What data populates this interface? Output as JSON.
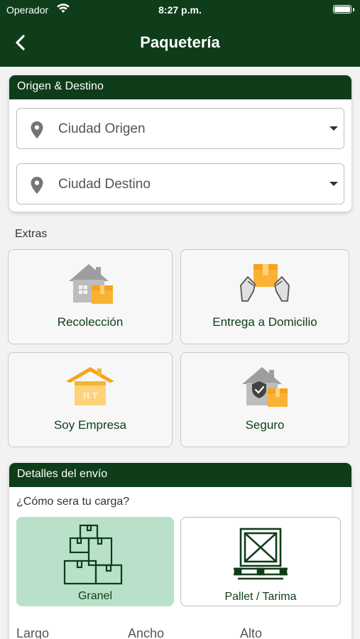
{
  "status_bar": {
    "carrier": "Operador",
    "time": "8:27 p.m."
  },
  "nav": {
    "title": "Paquetería"
  },
  "route": {
    "header": "Origen & Destino",
    "origin_placeholder": "Ciudad Origen",
    "destination_placeholder": "Ciudad Destino"
  },
  "extras": {
    "label": "Extras",
    "items": [
      {
        "label": "Recolección",
        "icon": "house-pickup-icon"
      },
      {
        "label": "Entrega a Domicilio",
        "icon": "package-delivery-icon"
      },
      {
        "label": "Soy Empresa",
        "icon": "company-building-icon"
      },
      {
        "label": "Seguro",
        "icon": "insurance-shield-icon"
      }
    ]
  },
  "details": {
    "header": "Detalles del envío",
    "question": "¿Cómo sera tu carga?",
    "options": [
      {
        "label": "Granel",
        "icon": "boxes-icon",
        "selected": true
      },
      {
        "label": "Pallet / Tarima",
        "icon": "pallet-crate-icon",
        "selected": false
      }
    ],
    "dimensions": [
      "Largo",
      "Ancho",
      "Alto"
    ]
  },
  "colors": {
    "primary": "#0f3d1a",
    "selected_option": "#b9e0c9",
    "accent_box": "#f9b233"
  }
}
